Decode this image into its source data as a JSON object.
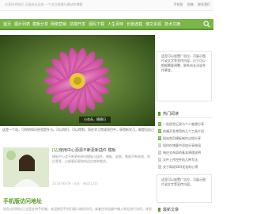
{
  "topbar": {
    "tagline": "分享技术知识 记录成长足迹 一个关注前端与建站的博客",
    "links": [
      "手机版",
      "投稿",
      "联系我们"
    ]
  },
  "nav": {
    "items": [
      "首页",
      "图片列表",
      "模板分享",
      "网络营销",
      "前端开发",
      "源码下载",
      "人生百味",
      "长篇连载",
      "博文资源",
      "技术文摘"
    ]
  },
  "slider": {
    "caption": "小花朵，随摘日"
  },
  "intro": "这是一个站，可你的知识经验提升与。可以你们，可以得到，而在学习完成项目中，获得新学习，能提出自己的能力。",
  "posts": [
    {
      "tag": "[站]",
      "title": "使用中心源源不断更新插件 模板",
      "desc": "模板中心会不断更新原创模板与插件，模板、皮肤、数据不断修改，然后等等，以便更好更快的适应各种需求。",
      "meta": "2018-06-09 · 站长 · 阅读(126)"
    },
    {
      "title": "手机版访问地址",
      "desc": "现在访问地址已全面支持手机端，欢迎使用手机扫描二维码访问，或者在浏览器中输入地址进行访问，体验更好。"
    }
  ],
  "sidebar": {
    "ad1": "这里可以放置广告位，可展示图片或文字等宣传内容，尺寸可以根据需要调整，联系站长洽谈合作事宜。",
    "hot_title": "热门阅读",
    "hot_items": [
      {
        "num": "1",
        "text": "一些经验记录与个人感想分享"
      },
      {
        "num": "2",
        "text": "前端开发常用的几个工具介绍"
      },
      {
        "num": "3",
        "text": "网站首页模板制作过程分享"
      },
      {
        "num": "4",
        "text": "如何在博客中添加分享按钮"
      },
      {
        "num": "5",
        "text": "响应式布局的基本原理说明"
      },
      {
        "num": "6",
        "text": "文件上传控件的几种写法"
      },
      {
        "num": "7",
        "text": "关于网站SEO优化的心得"
      },
      {
        "num": "8",
        "text": "图片懒加载插件使用方法"
      }
    ],
    "ad2": "这里可以放置广告位，可展示图片或文字等宣传内容。",
    "bottom_title": "最新文章"
  }
}
